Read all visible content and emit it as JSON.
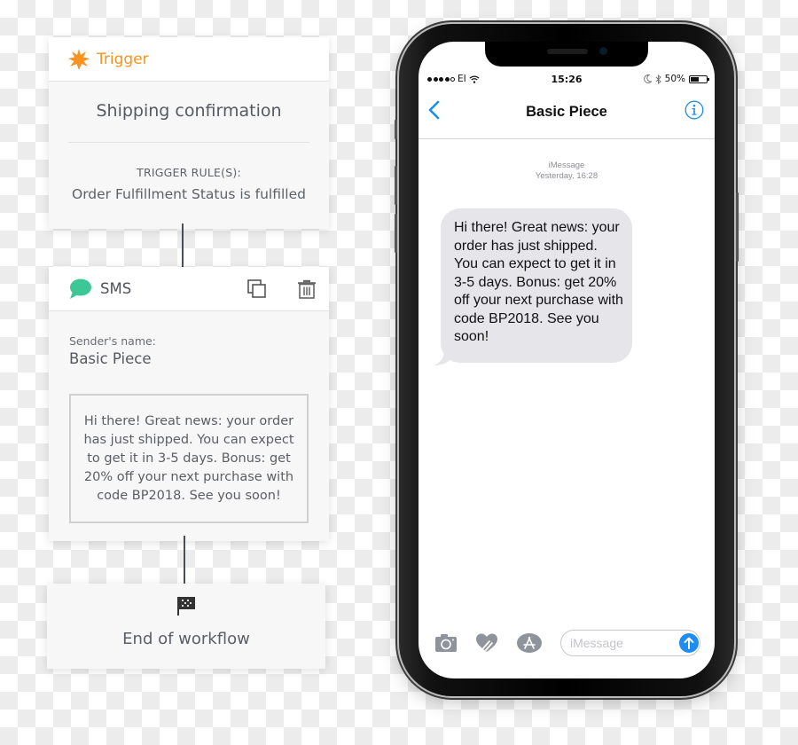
{
  "workflow": {
    "trigger": {
      "header_label": "Trigger",
      "icon": "starburst-icon",
      "name": "Shipping confirmation",
      "rule_label": "TRIGGER RULE(S):",
      "rule_value": "Order Fulfillment Status is fulfilled",
      "accent_color": "#f7931e"
    },
    "sms": {
      "header_label": "SMS",
      "icon": "speech-bubble-icon",
      "icon_color": "#3ec796",
      "actions": [
        "duplicate-icon",
        "trash-icon"
      ],
      "sender_label": "Sender's name:",
      "sender_value": "Basic Piece",
      "message": "Hi there! Great news: your order has just shipped. You can expect to get it in 3-5 days. Bonus: get 20% off your next purchase with code BP2018. See you soon!"
    },
    "end": {
      "icon": "checkered-flag-icon",
      "label": "End of workflow"
    }
  },
  "phone": {
    "status_bar": {
      "carrier": "EI",
      "signal_bars_filled": 4,
      "signal_bars_total": 5,
      "time": "15:26",
      "battery": "50%",
      "battery_level": 0.5
    },
    "nav": {
      "title": "Basic Piece",
      "accent_color": "#1e8cf0"
    },
    "conversation": {
      "service": "iMessage",
      "timestamp": "Yesterday, 16:28",
      "messages": [
        {
          "direction": "incoming",
          "text": "Hi there! Great news: your order has just shipped. You can expect to get it in 3-5 days. Bonus: get 20% off your next purchase with code BP2018. See you soon!"
        }
      ]
    },
    "compose": {
      "placeholder": "iMessage",
      "value": ""
    }
  }
}
